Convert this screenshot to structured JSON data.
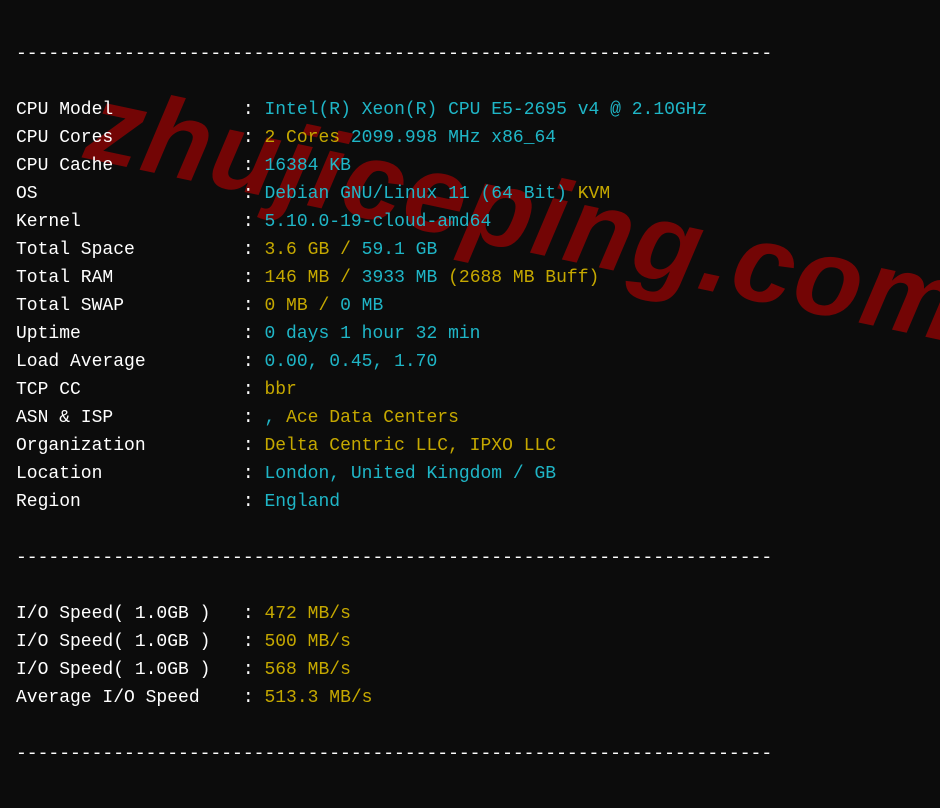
{
  "dashes": "----------------------------------------------------------------------",
  "rows": [
    {
      "label": "CPU Model            ",
      "parts": [
        {
          "cls": "cyan",
          "t": "Intel(R) Xeon(R) CPU E5-2695 v4 @ 2.10GHz"
        }
      ]
    },
    {
      "label": "CPU Cores            ",
      "parts": [
        {
          "cls": "yellow",
          "t": "2 Cores "
        },
        {
          "cls": "cyan",
          "t": "2099.998 MHz x86_64"
        }
      ]
    },
    {
      "label": "CPU Cache            ",
      "parts": [
        {
          "cls": "cyan",
          "t": "16384 KB"
        }
      ]
    },
    {
      "label": "OS                   ",
      "parts": [
        {
          "cls": "cyan",
          "t": "Debian GNU/Linux 11 (64 Bit) "
        },
        {
          "cls": "yellow",
          "t": "KVM"
        }
      ]
    },
    {
      "label": "Kernel               ",
      "parts": [
        {
          "cls": "cyan",
          "t": "5.10.0-19-cloud-amd64"
        }
      ]
    },
    {
      "label": "Total Space          ",
      "parts": [
        {
          "cls": "yellow",
          "t": "3.6 GB / "
        },
        {
          "cls": "cyan",
          "t": "59.1 GB"
        }
      ]
    },
    {
      "label": "Total RAM            ",
      "parts": [
        {
          "cls": "yellow",
          "t": "146 MB / "
        },
        {
          "cls": "cyan",
          "t": "3933 MB "
        },
        {
          "cls": "yellow",
          "t": "(2688 MB Buff)"
        }
      ]
    },
    {
      "label": "Total SWAP           ",
      "parts": [
        {
          "cls": "yellow",
          "t": "0 MB / "
        },
        {
          "cls": "cyan",
          "t": "0 MB"
        }
      ]
    },
    {
      "label": "Uptime               ",
      "parts": [
        {
          "cls": "cyan",
          "t": "0 days 1 hour 32 min"
        }
      ]
    },
    {
      "label": "Load Average         ",
      "parts": [
        {
          "cls": "cyan",
          "t": "0.00, 0.45, 1.70"
        }
      ]
    },
    {
      "label": "TCP CC               ",
      "parts": [
        {
          "cls": "yellow",
          "t": "bbr"
        }
      ]
    },
    {
      "label": "ASN & ISP            ",
      "parts": [
        {
          "cls": "cyan",
          "t": ", "
        },
        {
          "cls": "yellow",
          "t": "Ace Data Centers"
        }
      ]
    },
    {
      "label": "Organization         ",
      "parts": [
        {
          "cls": "yellow",
          "t": "Delta Centric LLC, IPXO LLC"
        }
      ]
    },
    {
      "label": "Location             ",
      "parts": [
        {
          "cls": "cyan",
          "t": "London, United Kingdom / GB"
        }
      ]
    },
    {
      "label": "Region               ",
      "parts": [
        {
          "cls": "cyan",
          "t": "England"
        }
      ]
    }
  ],
  "iorows": [
    {
      "label": "I/O Speed( 1.0GB )   ",
      "parts": [
        {
          "cls": "yellow",
          "t": "472 MB/s"
        }
      ]
    },
    {
      "label": "I/O Speed( 1.0GB )   ",
      "parts": [
        {
          "cls": "yellow",
          "t": "500 MB/s"
        }
      ]
    },
    {
      "label": "I/O Speed( 1.0GB )   ",
      "parts": [
        {
          "cls": "yellow",
          "t": "568 MB/s"
        }
      ]
    },
    {
      "label": "Average I/O Speed    ",
      "parts": [
        {
          "cls": "yellow",
          "t": "513.3 MB/s"
        }
      ]
    }
  ],
  "watermark": "zhujiceping.com"
}
